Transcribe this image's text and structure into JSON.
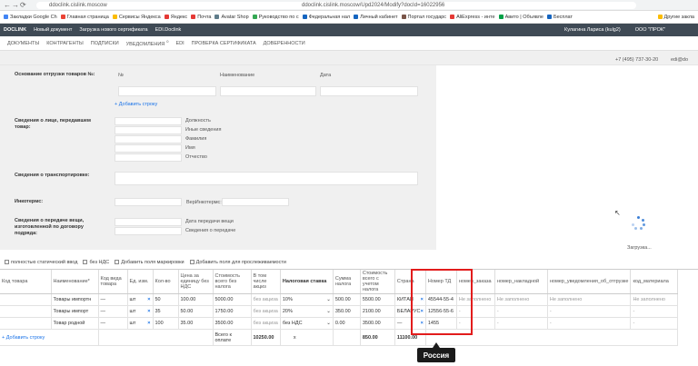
{
  "browser": {
    "url": "ddoclink.cislink.moscow",
    "url_center": "ddoclink.cislink.moscow/Upd2024/Modify?docId=16022956",
    "bookmarks": [
      "Закладки Google Ch",
      "Главная страница",
      "Сервисы Яндекса",
      "Яндекс",
      "Почта",
      "Avatar Shop",
      "Руководство по с",
      "Федеральная нал",
      "Личный кабинет",
      "Портал государс",
      "AliExpress - инте",
      "Авито | Объявле",
      "Бесплат",
      "Другие закла"
    ]
  },
  "appbar": {
    "logo": "DOCLINK",
    "new_doc": "Новый документ",
    "upload_cert": "Загрузка нового сертификата",
    "edi": "EDI.Doclink",
    "user": "Кулагина Лариса (kulg2)",
    "org": "ООО \"ПРОК\""
  },
  "menu": [
    "ДОКУМЕНТЫ",
    "КОНТРАГЕНТЫ",
    "ПОДПИСКИ",
    "УВЕДОМЛЕНИЯ",
    "EDI",
    "ПРОВЕРКА СЕРТИФИКАТА",
    "ДОВЕРЕННОСТИ"
  ],
  "menu_badge": "0",
  "contact": {
    "phone": "+7 (495) 737-30-20",
    "email": "edi@do"
  },
  "form": {
    "shipment_basis_label": "Основание отгрузки товаров №:",
    "col_no": "№",
    "col_name": "Наименование",
    "col_date": "Дата",
    "add_row": "Добавить строку",
    "transfer_person_label": "Сведения о лице, передавшем товар:",
    "person_fields": [
      "Должность",
      "Иные сведения",
      "Фамилия",
      "Имя",
      "Отчество"
    ],
    "transport_label": "Сведения о транспортировке:",
    "incoterms_label": "Инкотермс:",
    "incoterms_ver_label": "ВерИнкотермс:",
    "contract_label": "Сведения о передаче вещи, изготовленной по договору подряда:",
    "transfer_date": "Дата передачи вещи",
    "transfer_info": "Сведения о передаче"
  },
  "loading": "Загрузка...",
  "options": [
    "полностью статический ввод",
    "без НДС",
    "Добавить поля маркировки",
    "Добавить поля для прослеживаемости"
  ],
  "grid": {
    "headers": [
      "Код товара",
      "Наименование*",
      "Код вида товара",
      "Ед. изм.",
      "Кол-во",
      "Цена за единицу без НДС",
      "Стоимость всего без налога",
      "В том числе акциз",
      "Налоговая ставка",
      "Сумма налога",
      "Стоимость всего с учетом налога",
      "Страна",
      "Номер ТД",
      "номер_заказа",
      "номер_накладной",
      "номер_уведомления_об_отгрузке",
      "код_материала"
    ],
    "rows": [
      [
        "",
        "Товары импортн",
        "—",
        "шт",
        "50",
        "100.00",
        "5000.00",
        "без акциза",
        "10%",
        "500.00",
        "5500.00",
        "КИТАЙ",
        "45544-55-4",
        "Не заполнено",
        "Не заполнено",
        "Не заполнено",
        "Не заполнено"
      ],
      [
        "",
        "Товары импорт",
        "—",
        "шт",
        "35",
        "50.00",
        "1750.00",
        "без акциза",
        "20%",
        "350.00",
        "2100.00",
        "БЕЛАРУС",
        "12556-55-6",
        "-",
        "-",
        "-",
        "-"
      ],
      [
        "",
        "Товар родной",
        "—",
        "шт",
        "100",
        "35.00",
        "3500.00",
        "без акциза",
        "без НДС",
        "0.00",
        "3500.00",
        "—",
        "1455",
        "-",
        "-",
        "-",
        "-"
      ]
    ],
    "add_row": "Добавить строку",
    "total_label": "Всего к оплате",
    "total_no_tax": "10250.00",
    "total_excise": "x",
    "total_tax": "850.00",
    "total_with_tax": "11100.00"
  },
  "tooltip": "Россия"
}
